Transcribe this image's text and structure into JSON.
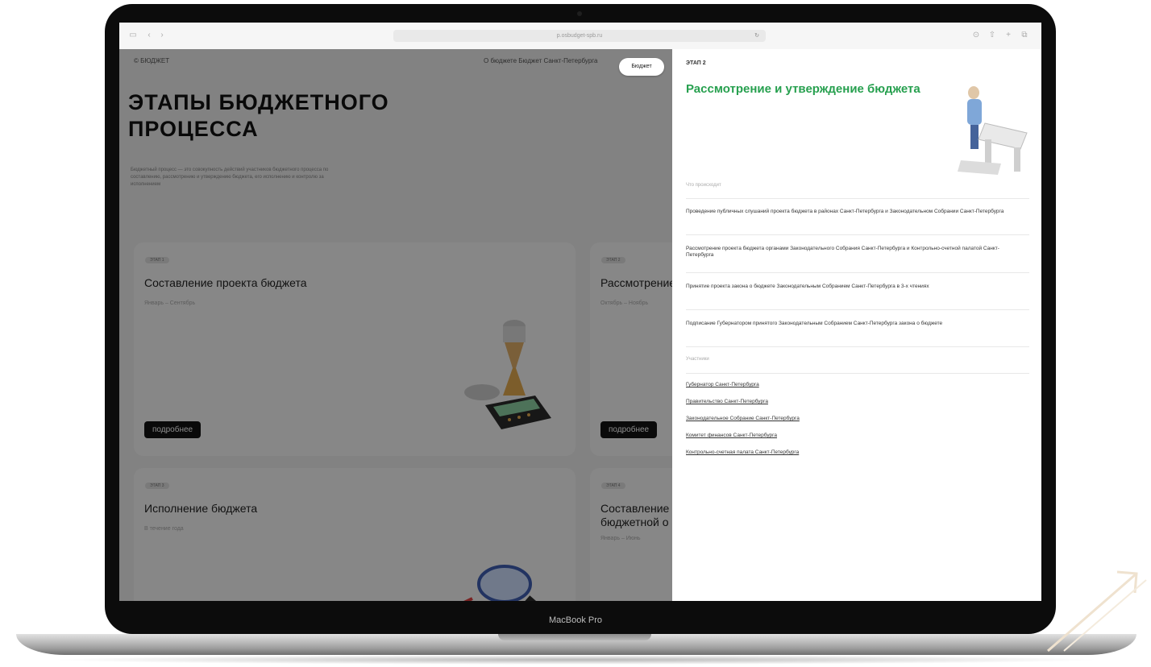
{
  "device": {
    "label": "MacBook Pro"
  },
  "browser": {
    "url": "p.osbudget-spb.ru"
  },
  "left_page": {
    "breadcrumb": "© БЮДЖЕТ",
    "nav_links": "О бюджете   Бюджет Санкт-Петербурга",
    "cta_label": "Бюджет",
    "title_line1": "ЭТАПЫ БЮДЖЕТНОГО",
    "title_line2": "ПРОЦЕССА",
    "intro": "Бюджетный процесс — это совокупность действий участников бюджетного процесса по составлению, рассмотрению и утверждению бюджета, его исполнению и контролю за исполнением",
    "cards": [
      {
        "chip": "ЭТАП 1",
        "title": "Составление проекта бюджета",
        "sub": "Январь – Сентябрь",
        "button": "подробнее"
      },
      {
        "chip": "ЭТАП 2",
        "title": "Рассмотрение",
        "sub": "Октябрь – Ноябрь",
        "button": "подробнее"
      },
      {
        "chip": "ЭТАП 3",
        "title": "Исполнение бюджета",
        "sub": "В течение года"
      },
      {
        "chip": "ЭТАП 4",
        "title_line1": "Составление",
        "title_line2": "бюджетной о",
        "sub": "Январь – Июнь"
      }
    ]
  },
  "panel": {
    "stage": "ЭТАП 2",
    "title": "Рассмотрение и утверждение бюджета",
    "steps_label": "Что происходит",
    "steps": [
      "Проведение публичных слушаний проекта бюджета в районах Санкт-Петербурга и Законодательном Собрании Санкт-Петербурга",
      "Рассмотрение проекта бюджета органами Законодательного Собрания Санкт-Петербурга и Контрольно-счетной палатой Санкт-Петербурга",
      "Принятие проекта закона о бюджете Законодательным Собранием Санкт-Петербурга в 3-х чтениях",
      "Подписание Губернатором принятого Законодательным Собранием Санкт-Петербурга закона о бюджете"
    ],
    "links_label": "Участники",
    "links": [
      "Губернатор Санкт-Петербурга",
      "Правительство Санкт-Петербурга",
      "Законодательное Собрание Санкт-Петербурга",
      "Комитет финансов Санкт-Петербурга",
      "Контрольно-счетная палата Санкт-Петербурга"
    ]
  }
}
